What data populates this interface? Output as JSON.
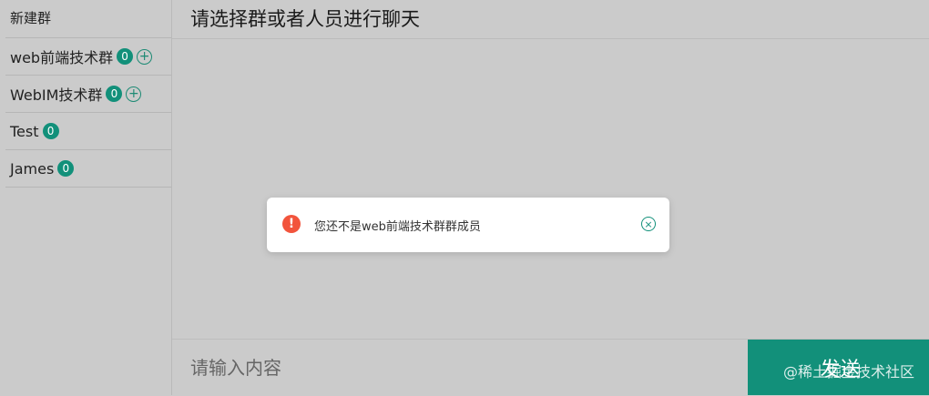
{
  "sidebar": {
    "new_group": "新建群",
    "items": [
      {
        "label": "web前端技术群",
        "count": "0",
        "add": "+"
      },
      {
        "label": "WebIM技术群",
        "count": "0",
        "add": "+"
      },
      {
        "label": "Test",
        "count": "0"
      },
      {
        "label": "James",
        "count": "0"
      }
    ]
  },
  "header": {
    "title": "请选择群或者人员进行聊天"
  },
  "composer": {
    "placeholder": "请输入内容",
    "send_label": "发送"
  },
  "toast": {
    "icon": "!",
    "message": "您还不是web前端技术群群成员",
    "close": "×"
  },
  "watermark": "@稀土掘金技术社区",
  "colors": {
    "accent": "#12907a",
    "error": "#f2543c",
    "background": "#cbcbcb"
  }
}
